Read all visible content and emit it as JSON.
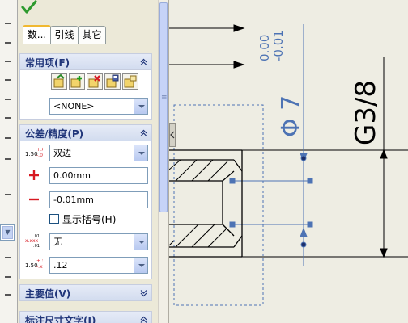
{
  "tabs": [
    {
      "label": "数..."
    },
    {
      "label": "引线"
    },
    {
      "label": "其它"
    }
  ],
  "favorites": {
    "title": "常用项(F)",
    "selected": "<NONE>"
  },
  "tolerance": {
    "title": "公差/精度(P)",
    "type_icon_text": "1.50",
    "type_value": "双边",
    "upper_value": "0.00mm",
    "lower_value": "-0.01mm",
    "show_parentheses_label": "显示括号(H)",
    "fit_value": "无",
    "precision_value": ".12"
  },
  "primary_value": {
    "title": "主要值(V)"
  },
  "dimension_text": {
    "title": "标注尺寸文字(I)"
  },
  "drawing": {
    "tol_upper": "0.00",
    "tol_lower": "-0.01",
    "diameter_text": "Φ 7",
    "thread_text": "G3/8"
  },
  "colors": {
    "panel_title": "#21367a",
    "selected_dim": "#4d73b4",
    "plus_minus_red": "#d71921"
  }
}
